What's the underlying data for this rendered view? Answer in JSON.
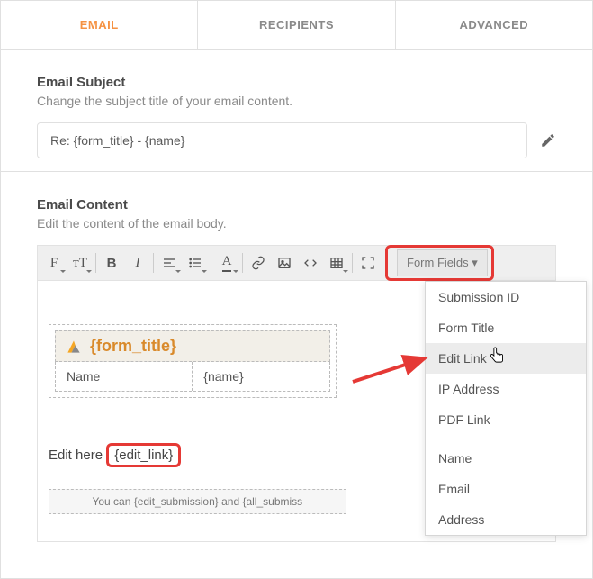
{
  "tabs": {
    "email": "EMAIL",
    "recipients": "RECIPIENTS",
    "advanced": "ADVANCED"
  },
  "subject": {
    "heading": "Email Subject",
    "desc": "Change the subject title of your email content.",
    "value": "Re: {form_title} - {name}"
  },
  "content": {
    "heading": "Email Content",
    "desc": "Edit the content of the email body.",
    "form_fields_label": "Form Fields ▾",
    "form_title_token": "{form_title}",
    "name_label": "Name",
    "name_token": "{name}",
    "edit_here_prefix": "Edit here ",
    "edit_link_token": "{edit_link}",
    "footer_text": "You can {edit_submission} and {all_submiss"
  },
  "dropdown": {
    "items": [
      "Submission ID",
      "Form Title",
      "Edit Link",
      "IP Address",
      "PDF Link"
    ],
    "items2": [
      "Name",
      "Email",
      "Address"
    ]
  },
  "toolbar": {
    "font_glyph": "F",
    "size_glyph": "ᴛT",
    "bold_glyph": "B",
    "italic_glyph": "I",
    "color_glyph": "A"
  }
}
